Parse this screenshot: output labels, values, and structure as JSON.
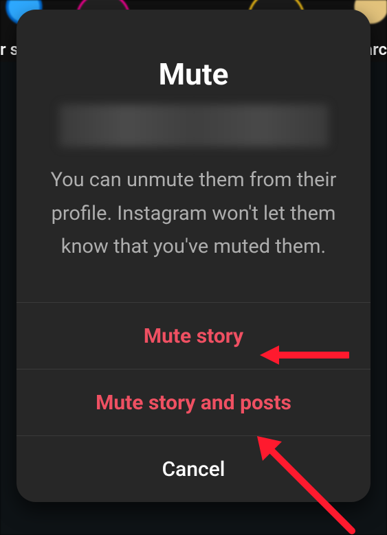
{
  "background": {
    "left_label_fragment": "r s",
    "right_label_fragment": "arc"
  },
  "dialog": {
    "title": "Mute",
    "description": "You can unmute them from their profile. Instagram won't let them know that you've muted them.",
    "buttons": {
      "mute_story": "Mute story",
      "mute_story_and_posts": "Mute story and posts",
      "cancel": "Cancel"
    }
  },
  "colors": {
    "danger": "#ef5062",
    "text": "#ffffff",
    "muted": "#aeaeae",
    "arrow": "#ff1a2e"
  }
}
